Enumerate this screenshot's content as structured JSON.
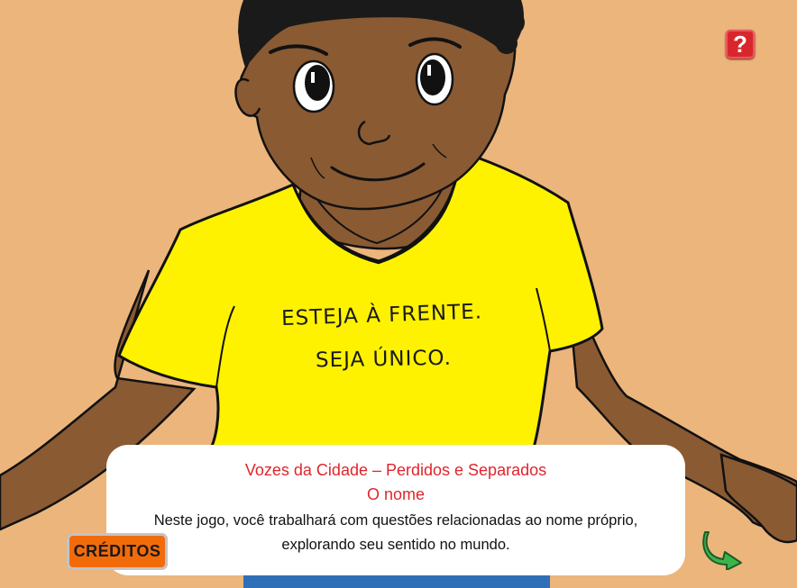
{
  "scene": {
    "shirt_line1": "ESTEJA À FRENTE.",
    "shirt_line2": "SEJA ÚNICO."
  },
  "help": {
    "label": "?"
  },
  "dialog": {
    "title": "Vozes da Cidade – Perdidos e Separados",
    "subtitle": "O nome",
    "description_line1": "Neste jogo, você trabalhará com questões relacionadas ao nome próprio,",
    "description_line2": "explorando seu sentido no mundo."
  },
  "buttons": {
    "credits_label": "CRÉDITOS",
    "next_icon": "curved-arrow-icon"
  },
  "colors": {
    "background": "#ebb57c",
    "skin": "#8a5a33",
    "shirt": "#fef200",
    "title_red": "#e0252c",
    "credits_orange": "#f26b0b",
    "next_green": "#3cb44a"
  }
}
